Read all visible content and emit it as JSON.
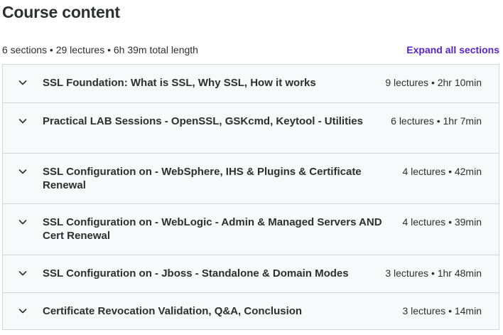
{
  "header": {
    "title": "Course content",
    "summary": "6 sections • 29 lectures • 6h 39m total length",
    "expand_label": "Expand all sections"
  },
  "sections": [
    {
      "title": "SSL Foundation: What is SSL, Why SSL, How it works",
      "meta": "9 lectures • 2hr 10min",
      "icon": "chevron-down-icon"
    },
    {
      "title": "Practical LAB Sessions - OpenSSL, GSKcmd, Keytool - Utilities",
      "meta": "6 lectures • 1hr 7min",
      "icon": "chevron-down-icon"
    },
    {
      "title": "SSL Configuration on - WebSphere, IHS & Plugins & Certificate Renewal",
      "meta": "4 lectures • 42min",
      "icon": "chevron-down-icon"
    },
    {
      "title": "SSL Configuration on - WebLogic - Admin & Managed Servers AND Cert Renewal",
      "meta": "4 lectures • 39min",
      "icon": "chevron-down-icon"
    },
    {
      "title": "SSL Configuration on - Jboss - Standalone & Domain Modes",
      "meta": "3 lectures • 1hr 48min",
      "icon": "chevron-down-icon"
    },
    {
      "title": "Certificate Revocation Validation, Q&A, Conclusion",
      "meta": "3 lectures • 14min",
      "icon": "chevron-down-icon"
    }
  ],
  "colors": {
    "accent": "#5624d0",
    "text": "#2d2f31",
    "section_bg": "#f7f9fa",
    "border": "#d1d7dc"
  }
}
